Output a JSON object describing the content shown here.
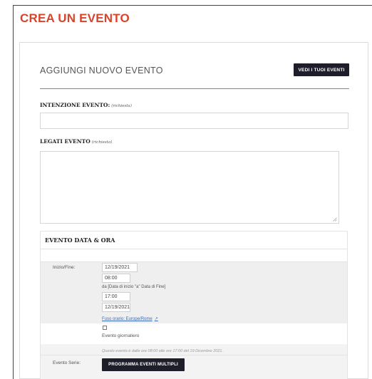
{
  "page": {
    "title": "CREA UN EVENTO"
  },
  "header": {
    "subtitle": "AGGIUNGI NUOVO EVENTO",
    "view_events_label": "VEDI I TUOI EVENTI"
  },
  "form": {
    "intent_label": "INTENZIONE EVENTO:",
    "intent_required": "(richiesta)",
    "intent_value": "",
    "legati_label": "LEGATI EVENTO",
    "legati_required": "(richiesta)",
    "legati_value": ""
  },
  "datetime": {
    "section_title": "EVENTO DATA & ORA",
    "start_end_label": "Inizio/Fine:",
    "start_date": "12/19/2021",
    "start_time": "08:00",
    "range_text": "da [Data di inizio \"a\" Data di Fine]",
    "end_time": "17:00",
    "end_date": "12/19/2021",
    "timezone_link": "Fuso orario: Europe/Rome",
    "all_day_label": "Evento giornaliero",
    "summary": "Questo evento è dalle ore 08:00 alle ore 17:00 del 19 Dicembre 2021."
  },
  "series": {
    "label": "Evento Serie:",
    "button_label": "PROGRAMMA EVENTI MULTIPLI"
  },
  "colors": {
    "accent": "#d9432b",
    "button_bg": "#1e1e2a",
    "link": "#3b6bb5"
  },
  "icons": {
    "external_link": "external-link-icon",
    "resize_grip": "resize-grip-icon",
    "checkbox": "checkbox-unchecked-icon"
  }
}
